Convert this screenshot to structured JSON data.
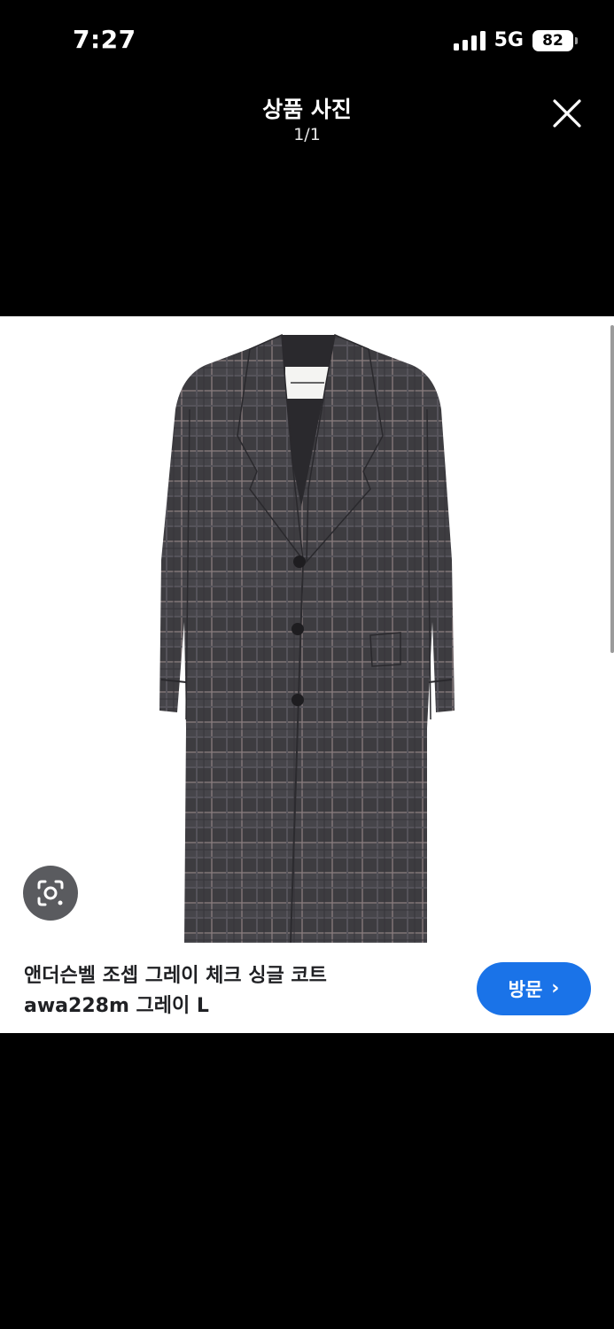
{
  "status": {
    "time": "7:27",
    "network": "5G",
    "battery": "82"
  },
  "header": {
    "title": "상품 사진",
    "counter": "1/1",
    "close_icon": "close-icon"
  },
  "photo": {
    "subject": "grey check single-breasted long coat",
    "lens_icon": "image-search-icon"
  },
  "product": {
    "title_line1": "앤더슨벨 조셉 그레이 체크 싱글 코트",
    "title_line2": "awa228m 그레이 L"
  },
  "visit": {
    "label": "방문",
    "icon": "chevron-right-icon",
    "color": "#1a73e8"
  }
}
